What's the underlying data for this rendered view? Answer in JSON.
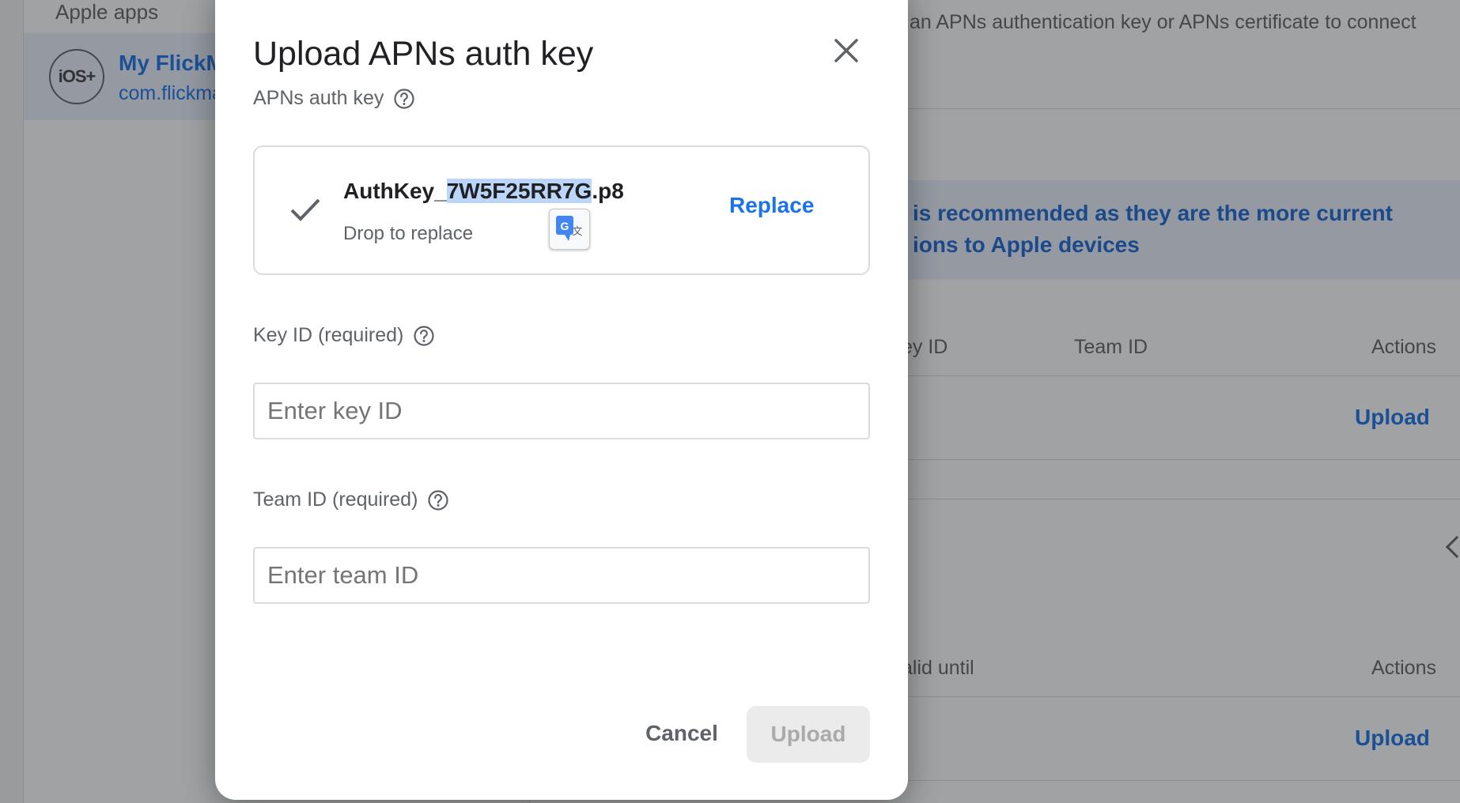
{
  "background": {
    "sidebar_heading": "Apple apps",
    "app_item": {
      "avatar_text": "iOS+",
      "name": "My FlickM",
      "bundle_id": "com.flickma"
    },
    "intro_text": "an APNs authentication key or APNs certificate to connect",
    "banner_lines": [
      "is recommended as they are the more current",
      "ions to Apple devices"
    ],
    "key_table": {
      "headers": [
        "ey ID",
        "Team ID",
        "Actions"
      ],
      "row_action": "Upload"
    },
    "cert_table": {
      "headers": [
        "alid until",
        "Actions"
      ],
      "row_action": "Upload"
    }
  },
  "dialog": {
    "title": "Upload APNs auth key",
    "auth_key": {
      "label": "APNs auth key",
      "file_name_prefix": "AuthKey_",
      "file_name_selected": "7W5F25RR7G",
      "file_name_suffix": ".p8",
      "hint": "Drop to replace",
      "replace_label": "Replace"
    },
    "key_id": {
      "label": "Key ID (required)",
      "placeholder": "Enter key ID",
      "value": ""
    },
    "team_id": {
      "label": "Team ID (required)",
      "placeholder": "Enter team ID",
      "value": ""
    },
    "buttons": {
      "cancel": "Cancel",
      "upload": "Upload",
      "upload_enabled": false
    }
  },
  "icons": [
    "close-icon",
    "help-icon",
    "check-icon",
    "google-translate-icon",
    "ios-icon",
    "chevron-icon"
  ],
  "colors": {
    "accent": "#1a73e8",
    "selection": "#bcd6fa",
    "banner_bg": "#e8f0fe",
    "disabled_bg": "#ebebeb"
  }
}
